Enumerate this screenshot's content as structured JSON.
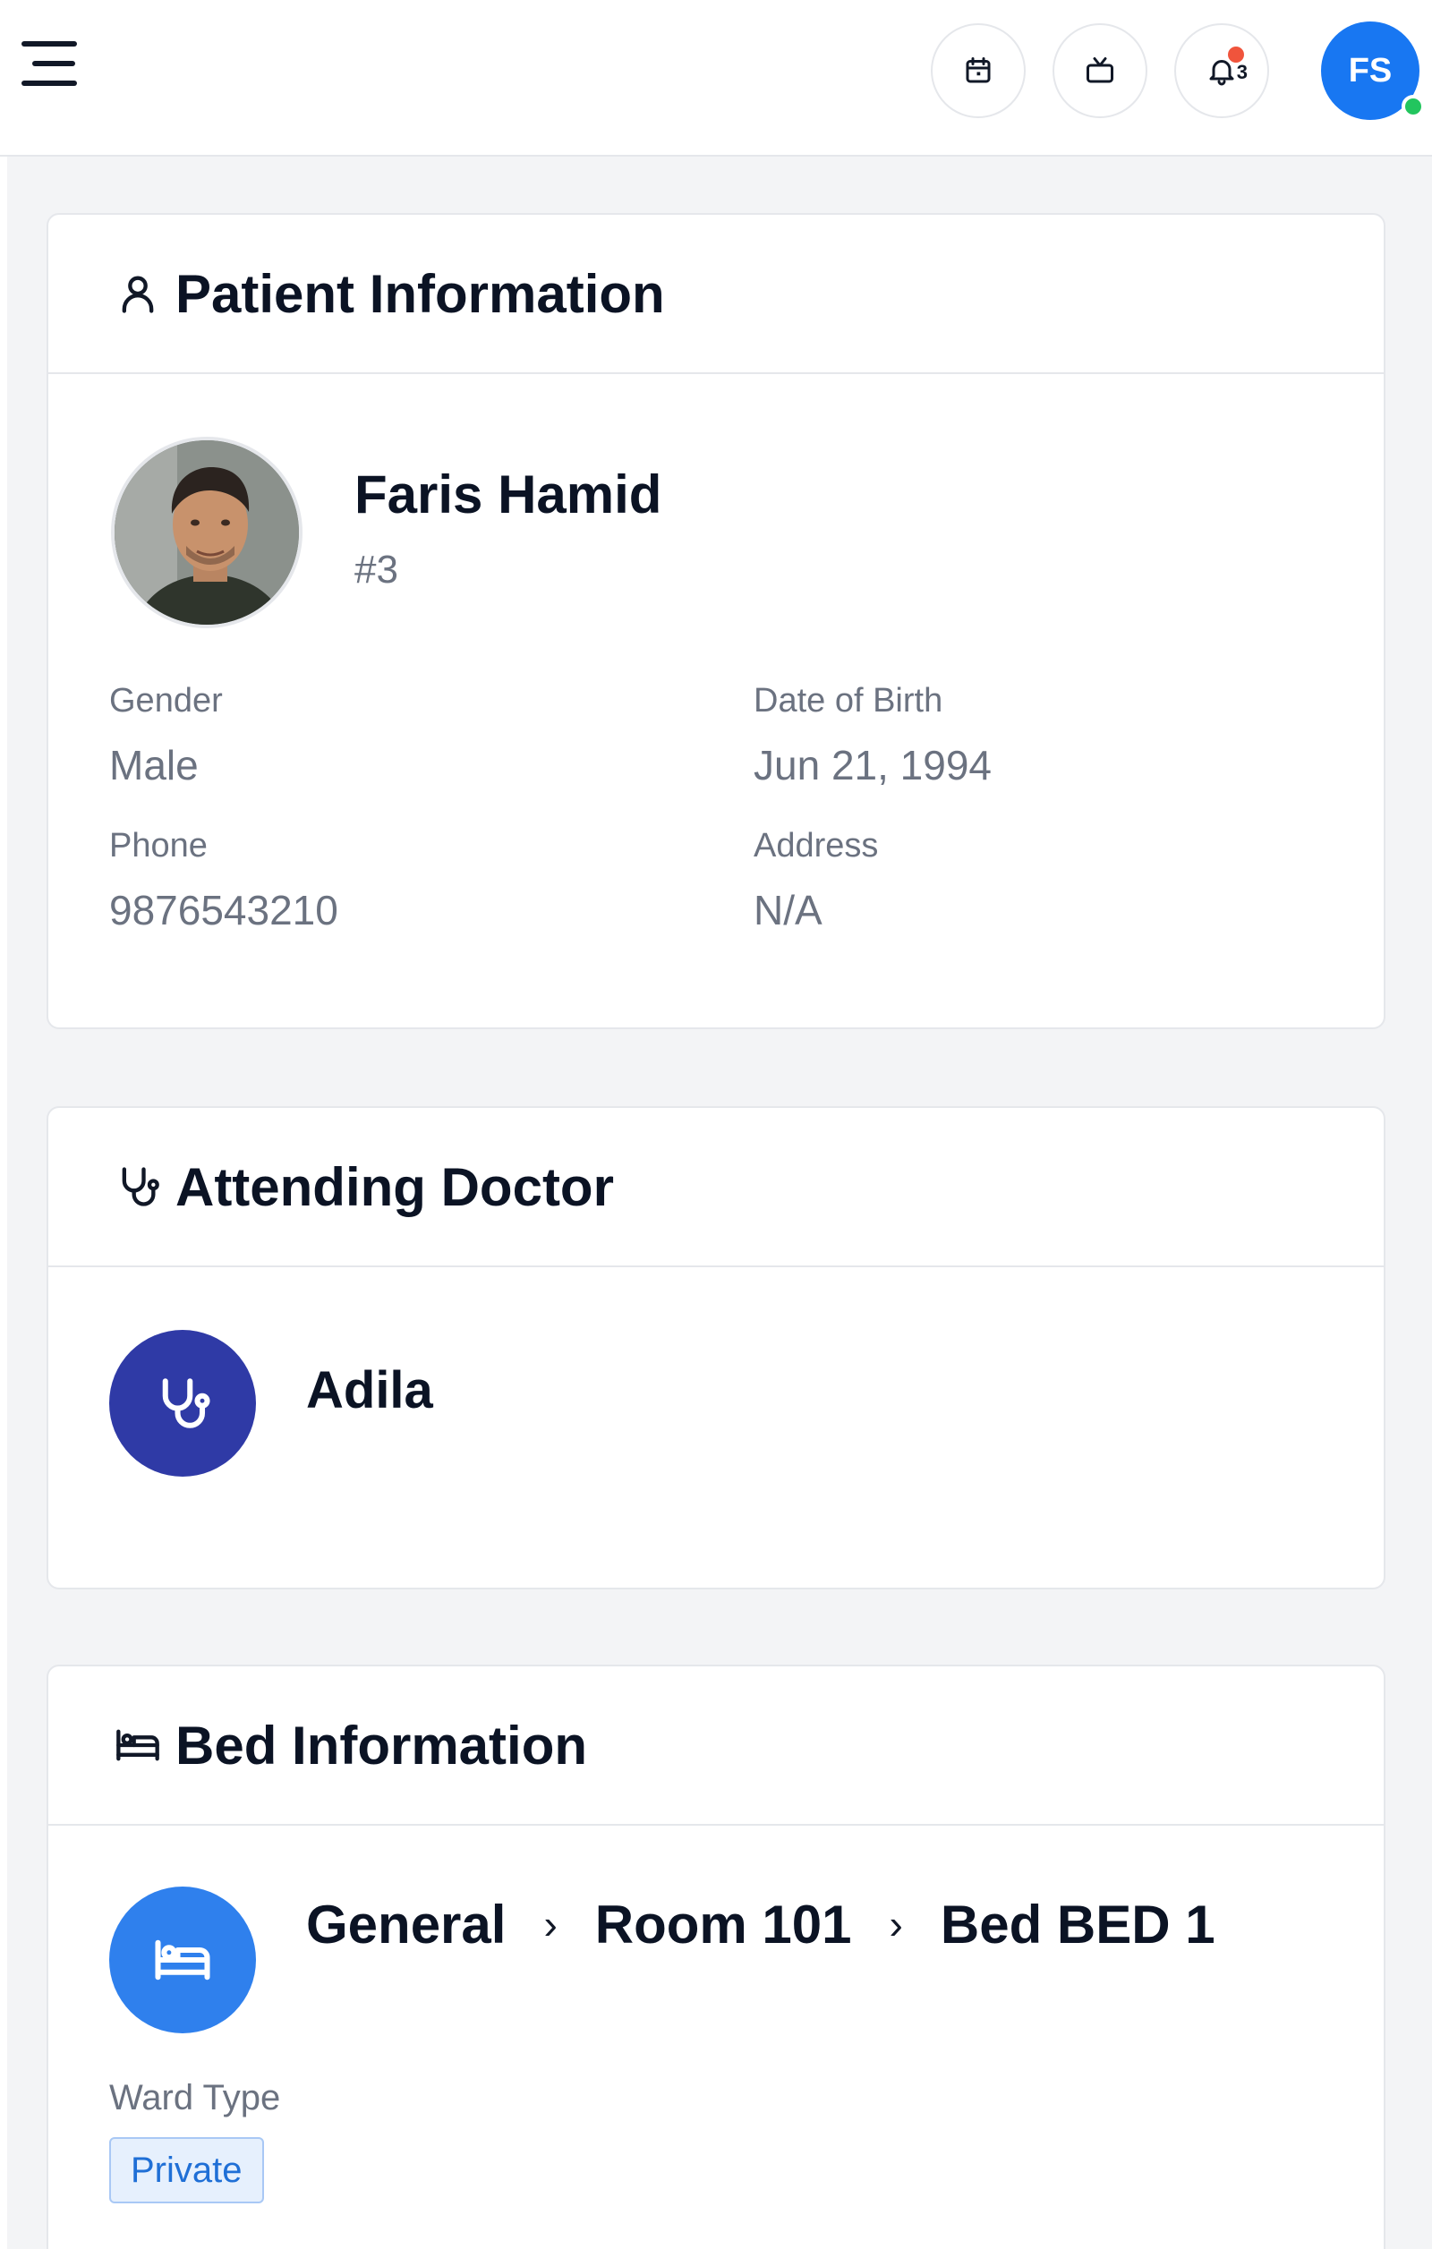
{
  "header": {
    "avatar_initials": "FS",
    "notification_count": "3",
    "icons": [
      "menu-icon",
      "calendar-icon",
      "tv-icon",
      "bell-icon"
    ]
  },
  "patient": {
    "section_title": "Patient Information",
    "name": "Faris Hamid",
    "id": "#3",
    "gender_label": "Gender",
    "gender": "Male",
    "dob_label": "Date of Birth",
    "dob": "Jun 21, 1994",
    "phone_label": "Phone",
    "phone": "9876543210",
    "address_label": "Address",
    "address": "N/A"
  },
  "doctor": {
    "section_title": "Attending Doctor",
    "name": "Adila"
  },
  "bed": {
    "section_title": "Bed Information",
    "ward": "General",
    "room": "Room 101",
    "bed": "Bed BED 1",
    "separator": "›",
    "ward_type_label": "Ward Type",
    "ward_type": "Private"
  },
  "colors": {
    "brand_blue": "#1877f2",
    "doctor_icon_bg": "#2f3aa6",
    "bed_icon_bg": "#2f80ed",
    "online": "#22c55e",
    "notification": "#f0543c"
  }
}
